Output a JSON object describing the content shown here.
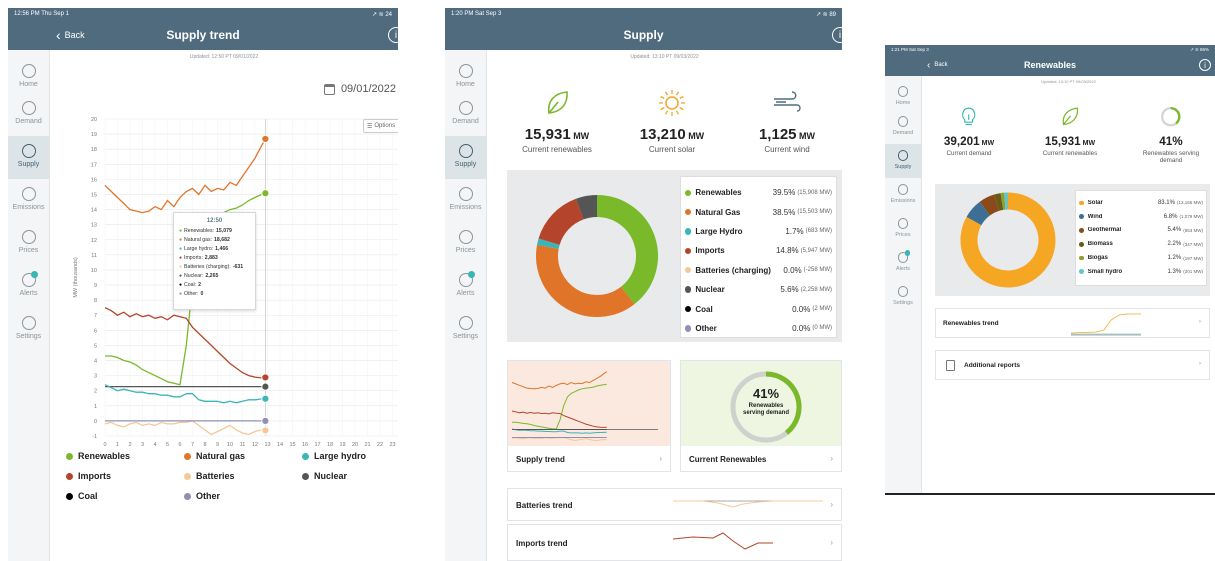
{
  "screen1": {
    "status_time": "12:56 PM  Thu Sep 1",
    "status_right": "↗ ≋ 24",
    "back_label": "Back",
    "title": "Supply trend",
    "info": "i",
    "updated": "Updated: 12:50 PT 09/01/2022",
    "date": "09/01/2022",
    "options_label": "Options",
    "ylabel": "MW (thousands)",
    "tooltip": {
      "time": "12:50",
      "rows": [
        {
          "label": "Renewables:",
          "value": "15,079",
          "color": "#7ab929"
        },
        {
          "label": "Natural gas:",
          "value": "18,682",
          "color": "#e0752a"
        },
        {
          "label": "Large hydro:",
          "value": "1,466",
          "color": "#3bb5b5"
        },
        {
          "label": "Imports:",
          "value": "2,883",
          "color": "#b5452a"
        },
        {
          "label": "Batteries (charging):",
          "value": "-631",
          "color": "#f4c896"
        },
        {
          "label": "Nuclear:",
          "value": "2,265",
          "color": "#555555"
        },
        {
          "label": "Coal:",
          "value": "2",
          "color": "#000000"
        },
        {
          "label": "Other:",
          "value": "0",
          "color": "#8f8fb8"
        }
      ]
    },
    "legend": [
      {
        "label": "Renewables",
        "color": "#7ab929"
      },
      {
        "label": "Natural gas",
        "color": "#e0752a"
      },
      {
        "label": "Large hydro",
        "color": "#3bb5b5"
      },
      {
        "label": "Imports",
        "color": "#b5452a"
      },
      {
        "label": "Batteries",
        "color": "#f4c896"
      },
      {
        "label": "Nuclear",
        "color": "#555555"
      },
      {
        "label": "Coal",
        "color": "#000000"
      },
      {
        "label": "Other",
        "color": "#8f8fb8"
      }
    ]
  },
  "sidebar_items": [
    {
      "label": "Home",
      "icon": "home-icon"
    },
    {
      "label": "Demand",
      "icon": "lightbulb-icon"
    },
    {
      "label": "Supply",
      "icon": "pie-icon"
    },
    {
      "label": "Emissions",
      "icon": "cloud-icon"
    },
    {
      "label": "Prices",
      "icon": "dollar-icon"
    },
    {
      "label": "Alerts",
      "icon": "bell-icon"
    },
    {
      "label": "Settings",
      "icon": "gear-icon"
    }
  ],
  "screen2": {
    "status_time": "1:20 PM  Sat Sep 3",
    "status_right": "↗ ≋ 89",
    "title": "Supply",
    "info": "i",
    "updated": "Updated: 13:10 PT 09/03/2022",
    "stats": [
      {
        "value": "15,931",
        "unit": "MW",
        "label": "Current renewables",
        "icon": "leaf-icon"
      },
      {
        "value": "13,210",
        "unit": "MW",
        "label": "Current solar",
        "icon": "sun-icon"
      },
      {
        "value": "1,125",
        "unit": "MW",
        "label": "Current wind",
        "icon": "wind-icon"
      }
    ],
    "breakdown": [
      {
        "name": "Renewables",
        "pct": "39.5%",
        "mw": "(15,908 MW)",
        "color": "#7ab929"
      },
      {
        "name": "Natural Gas",
        "pct": "38.5%",
        "mw": "(15,503 MW)",
        "color": "#e0752a"
      },
      {
        "name": "Large Hydro",
        "pct": "1.7%",
        "mw": "(683 MW)",
        "color": "#3bb5b5"
      },
      {
        "name": "Imports",
        "pct": "14.8%",
        "mw": "(5,947 MW)",
        "color": "#b5452a"
      },
      {
        "name": "Batteries (charging)",
        "pct": "0.0%",
        "mw": "(-258 MW)",
        "color": "#f4c896"
      },
      {
        "name": "Nuclear",
        "pct": "5.6%",
        "mw": "(2,258 MW)",
        "color": "#555555"
      },
      {
        "name": "Coal",
        "pct": "0.0%",
        "mw": "(2 MW)",
        "color": "#000000"
      },
      {
        "name": "Other",
        "pct": "0.0%",
        "mw": "(0 MW)",
        "color": "#8f8fb8"
      }
    ],
    "ring_pct": "41%",
    "ring_caption": "Renewables serving demand",
    "card_supply": "Supply trend",
    "card_current": "Current Renewables",
    "card_batteries": "Batteries trend",
    "card_imports": "Imports trend"
  },
  "screen3": {
    "status_time": "1:21 PM  Sat Sep 3",
    "status_right": "↗ ≋ 86%",
    "back_label": "Back",
    "title": "Renewables",
    "info": "i",
    "updated": "Updated: 13:10 PT 09/03/2022",
    "stats": [
      {
        "value": "39,201",
        "unit": "MW",
        "label": "Current demand",
        "icon": "lightbulb-icon"
      },
      {
        "value": "15,931",
        "unit": "MW",
        "label": "Current renewables",
        "icon": "leaf-icon"
      },
      {
        "value": "41%",
        "unit": "",
        "label": "Renewables serving demand",
        "icon": "ring-icon"
      }
    ],
    "breakdown": [
      {
        "name": "Solar",
        "pct": "83.1%",
        "mw": "(13,166 MW)",
        "color": "#f5a623"
      },
      {
        "name": "Wind",
        "pct": "6.8%",
        "mw": "(1,079 MW)",
        "color": "#3d6f95"
      },
      {
        "name": "Geothermal",
        "pct": "5.4%",
        "mw": "(853 MW)",
        "color": "#8a4a1a"
      },
      {
        "name": "Biomass",
        "pct": "2.2%",
        "mw": "(347 MW)",
        "color": "#6b5a16"
      },
      {
        "name": "Biogas",
        "pct": "1.2%",
        "mw": "(197 MW)",
        "color": "#8fa02b"
      },
      {
        "name": "Small hydro",
        "pct": "1.3%",
        "mw": "(201 MW)",
        "color": "#66c5c2"
      }
    ],
    "card_trend": "Renewables trend",
    "card_reports": "Additional reports"
  },
  "chart_data": [
    {
      "type": "line",
      "x": [
        0,
        0.5,
        1,
        1.5,
        2,
        2.5,
        3,
        3.5,
        4,
        4.5,
        5,
        5.5,
        6,
        6.5,
        7,
        7.5,
        8,
        8.5,
        9,
        9.5,
        10,
        10.5,
        11,
        11.5,
        12,
        12.5,
        12.83
      ],
      "xlim": [
        0,
        24
      ],
      "ylim": [
        -1,
        20
      ],
      "xticks": [
        0,
        1,
        2,
        3,
        4,
        5,
        6,
        7,
        8,
        9,
        10,
        11,
        12,
        13,
        14,
        15,
        16,
        17,
        18,
        19,
        20,
        21,
        22,
        23
      ],
      "yticks": [
        -1,
        0,
        1,
        2,
        3,
        4,
        5,
        6,
        7,
        8,
        9,
        10,
        11,
        12,
        13,
        14,
        15,
        16,
        17,
        18,
        19,
        20
      ],
      "ylabel": "MW (thousands)",
      "grid": true,
      "series": [
        {
          "name": "Natural gas",
          "color": "#e0752a",
          "values": [
            15.6,
            15.2,
            14.8,
            14.4,
            14.0,
            13.9,
            13.8,
            13.9,
            14.2,
            14.0,
            14.6,
            14.2,
            14.8,
            15.2,
            15.4,
            15.0,
            15.6,
            15.2,
            15.4,
            15.3,
            15.8,
            15.6,
            16.2,
            16.8,
            17.4,
            18.2,
            18.68
          ]
        },
        {
          "name": "Renewables",
          "color": "#7ab929",
          "values": [
            4.3,
            4.3,
            4.2,
            4.0,
            3.9,
            3.7,
            3.4,
            3.2,
            3.0,
            2.8,
            2.6,
            2.5,
            2.4,
            5.0,
            9.0,
            11.5,
            12.5,
            13.0,
            13.5,
            13.8,
            14.0,
            14.1,
            14.3,
            14.6,
            14.8,
            15.0,
            15.08
          ]
        },
        {
          "name": "Imports",
          "color": "#b5452a",
          "values": [
            7.5,
            7.3,
            7.0,
            7.2,
            6.9,
            7.1,
            6.9,
            7.0,
            6.8,
            6.9,
            6.7,
            7.0,
            6.9,
            6.8,
            6.2,
            5.8,
            5.4,
            5.0,
            4.6,
            4.2,
            3.8,
            3.5,
            3.2,
            3.0,
            2.9,
            2.85,
            2.88
          ]
        },
        {
          "name": "Nuclear",
          "color": "#555555",
          "values": [
            2.27,
            2.27,
            2.27,
            2.27,
            2.27,
            2.27,
            2.27,
            2.27,
            2.27,
            2.27,
            2.27,
            2.27,
            2.27,
            2.27,
            2.27,
            2.27,
            2.27,
            2.27,
            2.27,
            2.27,
            2.27,
            2.27,
            2.27,
            2.27,
            2.27,
            2.27,
            2.27
          ]
        },
        {
          "name": "Large hydro",
          "color": "#3bb5b5",
          "values": [
            2.4,
            2.2,
            2.0,
            2.1,
            2.0,
            1.9,
            1.9,
            1.8,
            1.8,
            1.7,
            1.7,
            1.6,
            1.6,
            1.8,
            1.8,
            1.4,
            1.3,
            1.3,
            1.3,
            1.2,
            1.3,
            1.2,
            1.3,
            1.4,
            1.4,
            1.45,
            1.47
          ]
        },
        {
          "name": "Batteries",
          "color": "#f4c896",
          "values": [
            -0.2,
            -0.1,
            -0.3,
            -0.4,
            -0.2,
            -0.1,
            -0.3,
            -0.2,
            -0.3,
            -0.1,
            -0.2,
            -0.2,
            -0.1,
            -0.1,
            0.0,
            -0.3,
            -0.6,
            -0.9,
            -0.7,
            -0.5,
            -0.3,
            -0.6,
            -0.8,
            -0.9,
            -0.7,
            -0.6,
            -0.63
          ]
        },
        {
          "name": "Other",
          "color": "#8f8fb8",
          "values": [
            0,
            0,
            0,
            0,
            0,
            0,
            0,
            0,
            0,
            0,
            0,
            0,
            0,
            0,
            0,
            0,
            0,
            0,
            0,
            0,
            0,
            0,
            0,
            0,
            0,
            0,
            0
          ]
        }
      ]
    },
    {
      "type": "pie",
      "categories": [
        "Renewables",
        "Natural Gas",
        "Large Hydro",
        "Imports",
        "Batteries (charging)",
        "Nuclear",
        "Coal",
        "Other"
      ],
      "values": [
        39.5,
        38.5,
        1.7,
        14.8,
        0.0,
        5.6,
        0.0,
        0.0
      ],
      "colors": [
        "#7ab929",
        "#e0752a",
        "#3bb5b5",
        "#b5452a",
        "#f4c896",
        "#555555",
        "#000000",
        "#8f8fb8"
      ]
    },
    {
      "type": "pie",
      "categories": [
        "Solar",
        "Wind",
        "Geothermal",
        "Biomass",
        "Biogas",
        "Small hydro"
      ],
      "values": [
        83.1,
        6.8,
        5.4,
        2.2,
        1.2,
        1.3
      ],
      "colors": [
        "#f5a623",
        "#3d6f95",
        "#8a4a1a",
        "#6b5a16",
        "#8fa02b",
        "#66c5c2"
      ]
    }
  ]
}
